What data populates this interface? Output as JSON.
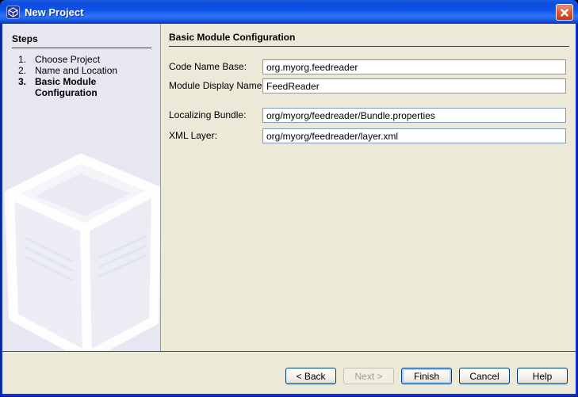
{
  "window": {
    "title": "New Project"
  },
  "colors": {
    "titlebar_blue": "#0f52e6",
    "window_border_blue": "#0831d9",
    "panel_beige": "#ece9d8",
    "steps_panel_lavender": "#e6e7f1",
    "close_button_red": "#cc3a17",
    "input_border": "#7f9db9",
    "default_button_focus_ring": "#a9c8f2"
  },
  "steps_panel": {
    "header": "Steps",
    "items": [
      {
        "num": "1.",
        "label": "Choose Project",
        "current": false
      },
      {
        "num": "2.",
        "label": "Name and Location",
        "current": false
      },
      {
        "num": "3.",
        "label": "Basic Module Configuration",
        "current": true
      }
    ]
  },
  "main": {
    "header": "Basic Module Configuration",
    "fields": [
      {
        "label": "Code Name Base:",
        "value": "org.myorg.feedreader"
      },
      {
        "label": "Module Display Name:",
        "value": "FeedReader"
      },
      {
        "label": "Localizing Bundle:",
        "value": "org/myorg/feedreader/Bundle.properties"
      },
      {
        "label": "XML Layer:",
        "value": "org/myorg/feedreader/layer.xml"
      }
    ]
  },
  "buttons": {
    "back": {
      "label": "< Back",
      "enabled": true
    },
    "next": {
      "label": "Next >",
      "enabled": false
    },
    "finish": {
      "label": "Finish",
      "enabled": true,
      "default": true
    },
    "cancel": {
      "label": "Cancel",
      "enabled": true
    },
    "help": {
      "label": "Help",
      "enabled": true
    }
  }
}
